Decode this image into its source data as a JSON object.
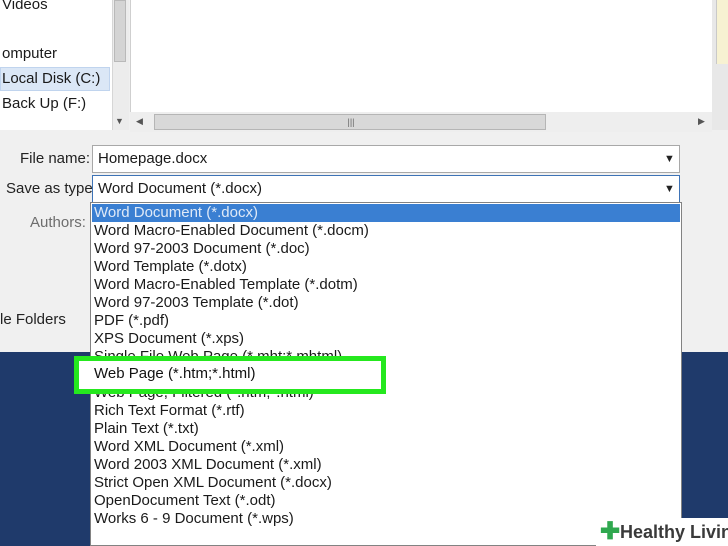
{
  "nav": {
    "items": [
      "Videos",
      "omputer",
      "Local Disk (C:)",
      "Back Up (F:)"
    ]
  },
  "form": {
    "file_name_label": "File name:",
    "file_name_value": "Homepage.docx",
    "save_type_label": "Save as type:",
    "save_type_value": "Word Document (*.docx)",
    "authors_label": "Authors:",
    "hide_folders_label": "le Folders"
  },
  "dropdown": {
    "options": [
      "Word Document (*.docx)",
      "Word Macro-Enabled Document (*.docm)",
      "Word 97-2003 Document (*.doc)",
      "Word Template (*.dotx)",
      "Word Macro-Enabled Template (*.dotm)",
      "Word 97-2003 Template (*.dot)",
      "PDF (*.pdf)",
      "XPS Document (*.xps)",
      "Single File Web Page (*.mht;*.mhtml)",
      "Web Page (*.htm;*.html)",
      "Web Page, Filtered (*.htm;*.html)",
      "Rich Text Format (*.rtf)",
      "Plain Text (*.txt)",
      "Word XML Document (*.xml)",
      "Word 2003 XML Document (*.xml)",
      "Strict Open XML Document (*.docx)",
      "OpenDocument Text (*.odt)",
      "Works 6 - 9 Document (*.wps)"
    ],
    "highlighted": "Web Page (*.htm;*.html)"
  },
  "watermark": {
    "plus": "✚",
    "text": "Healthy Living"
  },
  "colors": {
    "selection": "#3a7fd2",
    "highlight_border": "#25e81e",
    "background": "#1f3a6b"
  },
  "icons": {
    "scroll_grip": "grip-icon",
    "dropdown_arrow": "chevron-down-icon"
  }
}
